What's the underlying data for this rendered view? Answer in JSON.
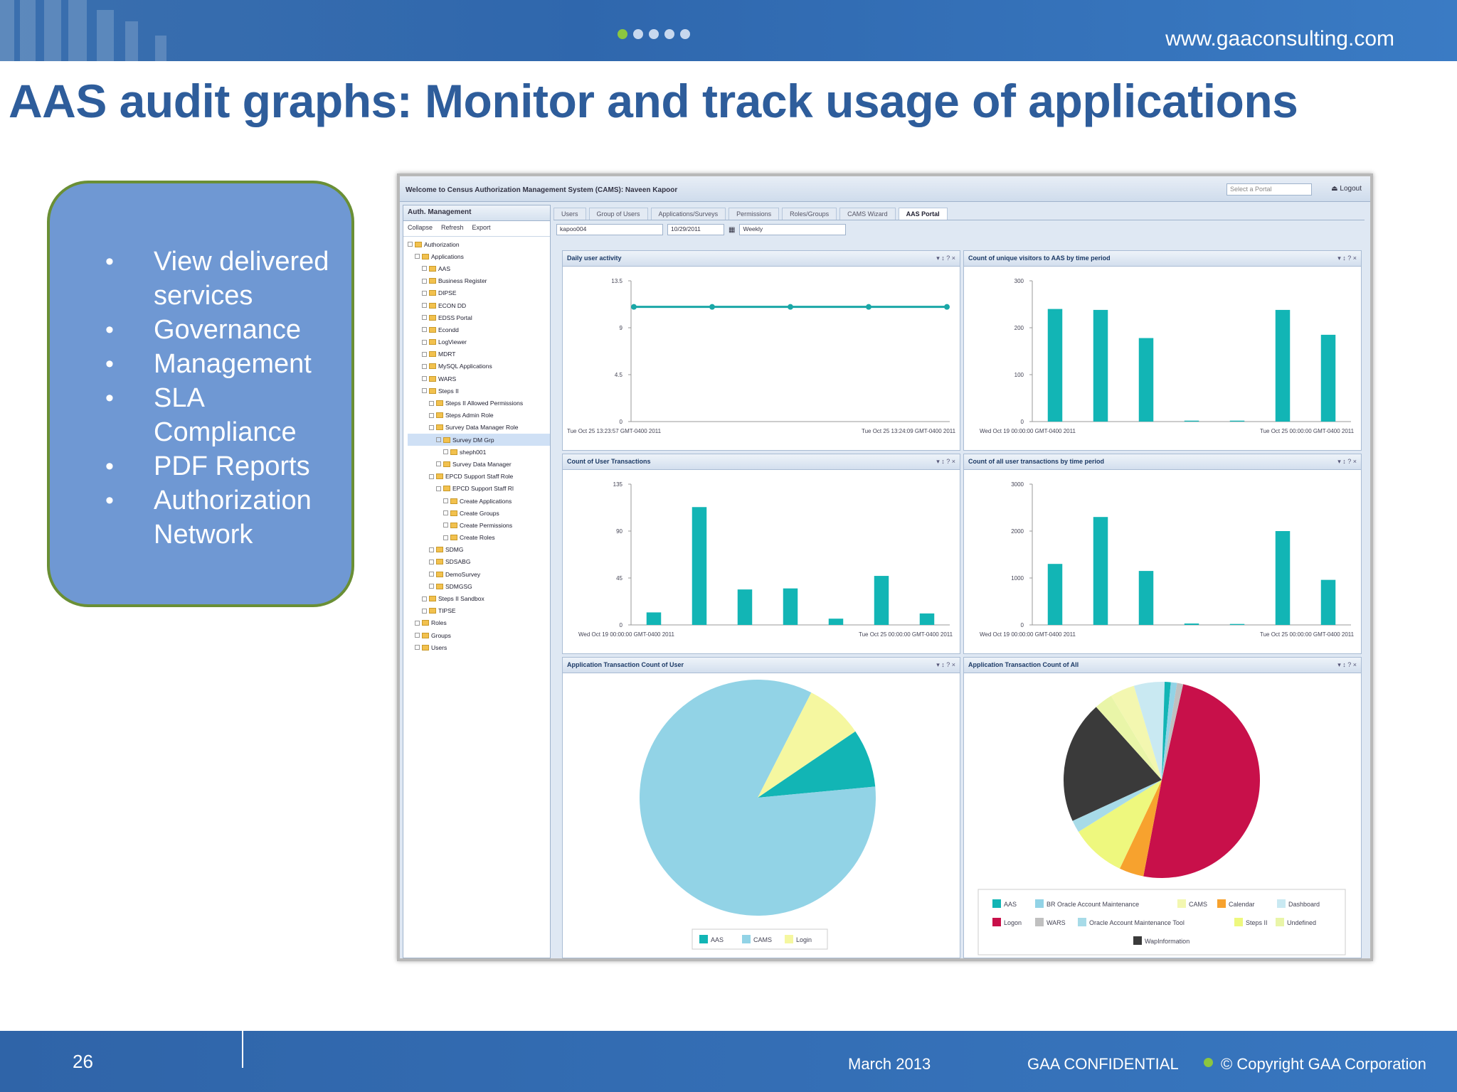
{
  "header": {
    "url": "www.gaaconsulting.com",
    "progress_dots": 5,
    "active_dot": 1,
    "accent": "#8cc63f",
    "bar_color": "#3470b5"
  },
  "slide": {
    "title": "AAS audit graphs: Monitor and track usage of applications",
    "title_color": "#2e5d9b",
    "bullets": [
      "View delivered services",
      "Governance",
      "Management",
      "SLA Compliance",
      "PDF Reports",
      "Authorization Network"
    ]
  },
  "app": {
    "window_title": "Welcome to Census Authorization Management System (CAMS): Naveen Kapoor",
    "portal_select_placeholder": "Select a Portal",
    "logout_label": "Logout",
    "sidebar_title": "Auth. Management",
    "sidebar_tools": [
      "Collapse",
      "Refresh",
      "Export"
    ],
    "tree": [
      {
        "label": "Authorization",
        "depth": 0
      },
      {
        "label": "Applications",
        "depth": 1
      },
      {
        "label": "AAS",
        "depth": 2
      },
      {
        "label": "Business Register",
        "depth": 2
      },
      {
        "label": "DIPSE",
        "depth": 2
      },
      {
        "label": "ECON DD",
        "depth": 2
      },
      {
        "label": "EDSS Portal",
        "depth": 2
      },
      {
        "label": "Econdd",
        "depth": 2
      },
      {
        "label": "LogViewer",
        "depth": 2
      },
      {
        "label": "MDRT",
        "depth": 2
      },
      {
        "label": "MySQL Applications",
        "depth": 2
      },
      {
        "label": "WARS",
        "depth": 2
      },
      {
        "label": "Steps II",
        "depth": 2
      },
      {
        "label": "Steps II Allowed Permissions",
        "depth": 3
      },
      {
        "label": "Steps Admin Role",
        "depth": 3
      },
      {
        "label": "Survey Data Manager Role",
        "depth": 3
      },
      {
        "label": "Survey DM Grp",
        "depth": 4,
        "selected": true
      },
      {
        "label": "sheph001",
        "depth": 5
      },
      {
        "label": "Survey Data Manager",
        "depth": 4
      },
      {
        "label": "EPCD Support Staff Role",
        "depth": 3
      },
      {
        "label": "EPCD Support Staff Rl",
        "depth": 4
      },
      {
        "label": "Create Applications",
        "depth": 5
      },
      {
        "label": "Create Groups",
        "depth": 5
      },
      {
        "label": "Create Permissions",
        "depth": 5
      },
      {
        "label": "Create Roles",
        "depth": 5
      },
      {
        "label": "SDMG",
        "depth": 3
      },
      {
        "label": "SDSABG",
        "depth": 3
      },
      {
        "label": "DemoSurvey",
        "depth": 3
      },
      {
        "label": "SDMGSG",
        "depth": 3
      },
      {
        "label": "Steps II Sandbox",
        "depth": 2
      },
      {
        "label": "TIPSE",
        "depth": 2
      },
      {
        "label": "Roles",
        "depth": 1
      },
      {
        "label": "Groups",
        "depth": 1
      },
      {
        "label": "Users",
        "depth": 1
      }
    ],
    "tabs": [
      {
        "label": "Users"
      },
      {
        "label": "Group of Users"
      },
      {
        "label": "Applications/Surveys"
      },
      {
        "label": "Permissions"
      },
      {
        "label": "Roles/Groups"
      },
      {
        "label": "CAMS Wizard"
      },
      {
        "label": "AAS Portal",
        "active": true
      }
    ],
    "filters": {
      "user": "kapoo004",
      "date": "10/29/2011",
      "period": "Weekly"
    },
    "panel_controls": "▾ ↕ ? ×"
  },
  "chart_data": [
    {
      "type": "line",
      "title": "Daily user activity",
      "x": [
        "Tue Oct 25 13:23:57 GMT-0400 2011",
        "",
        "",
        "Tue Oct 25 13:24:09 GMT-0400 2011",
        ""
      ],
      "series": [
        {
          "values": [
            11,
            11,
            11,
            11,
            11
          ]
        }
      ],
      "ylim": [
        0,
        13.5
      ],
      "yticks": [
        "13.5",
        "9",
        "4.5",
        "0"
      ],
      "xticks": [
        "Tue Oct 25 13:23:57 GMT-0400 2011",
        "Tue Oct 25 13:24:09 GMT-0400 2011"
      ],
      "color": "#1aa7a7"
    },
    {
      "type": "bar",
      "title": "Count of unique visitors to AAS by time period",
      "categories": [
        "1",
        "2",
        "3",
        "4",
        "5",
        "6",
        "7"
      ],
      "values": [
        240,
        238,
        178,
        2,
        2,
        238,
        185
      ],
      "ylim": [
        0,
        300
      ],
      "yticks": [
        "300",
        "200",
        "100",
        "0"
      ],
      "xticks": [
        "Wed Oct 19 00:00:00 GMT-0400 2011",
        "Tue Oct 25 00:00:00 GMT-0400 2011"
      ],
      "color": "#12b5b5"
    },
    {
      "type": "bar",
      "title": "Count of User Transactions",
      "categories": [
        "1",
        "2",
        "3",
        "4",
        "5",
        "6",
        "7"
      ],
      "values": [
        12,
        113,
        34,
        35,
        6,
        47,
        11
      ],
      "ylim": [
        0,
        135
      ],
      "yticks": [
        "135",
        "90",
        "45",
        "0"
      ],
      "xticks": [
        "Wed Oct 19 00:00:00 GMT-0400 2011",
        "Tue Oct 25 00:00:00 GMT-0400 2011"
      ],
      "color": "#12b5b5"
    },
    {
      "type": "bar",
      "title": "Count of all user transactions by time period",
      "categories": [
        "1",
        "2",
        "3",
        "4",
        "5",
        "6",
        "7"
      ],
      "values": [
        1300,
        2300,
        1150,
        30,
        20,
        2000,
        960
      ],
      "ylim": [
        0,
        3000
      ],
      "yticks": [
        "3000",
        "2000",
        "1000",
        "0"
      ],
      "xticks": [
        "Wed Oct 19 00:00:00 GMT-0400 2011",
        "Tue Oct 25 00:00:00 GMT-0400 2011"
      ],
      "color": "#12b5b5"
    },
    {
      "type": "pie",
      "title": "Application Transaction Count of User",
      "slices": [
        {
          "label": "AAS",
          "value": 8,
          "color": "#12b5b5"
        },
        {
          "label": "CAMS",
          "value": 84,
          "color": "#92d3e6"
        },
        {
          "label": "Login",
          "value": 8,
          "color": "#f5f7a0"
        }
      ]
    },
    {
      "type": "pie",
      "title": "Application Transaction Count of All",
      "slices": [
        {
          "label": "Logon",
          "value": 49,
          "color": "#c8104a"
        },
        {
          "label": "Calendar",
          "value": 4,
          "color": "#f7a22e"
        },
        {
          "label": "Steps II",
          "value": 9,
          "color": "#eef87e"
        },
        {
          "label": "Oracle Account Maintenance Tool",
          "value": 2,
          "color": "#a7dbe8"
        },
        {
          "label": "WapInformation",
          "value": 20,
          "color": "#3a3a3a"
        },
        {
          "label": "Undefined",
          "value": 3,
          "color": "#e9f5a8"
        },
        {
          "label": "CAMS",
          "value": 4,
          "color": "#f3f7b0"
        },
        {
          "label": "Dashboard",
          "value": 5,
          "color": "#c9e9f2"
        },
        {
          "label": "AAS",
          "value": 1,
          "color": "#12b5b5"
        },
        {
          "label": "BR Oracle Account Maintenance",
          "value": 1,
          "color": "#92d3e6"
        },
        {
          "label": "WARS",
          "value": 1,
          "color": "#c0c0c0"
        }
      ],
      "legend": [
        "AAS",
        "BR Oracle Account Maintenance",
        "CAMS",
        "Calendar",
        "Dashboard",
        "Logon",
        "WARS",
        "Oracle Account Maintenance Tool",
        "Steps II",
        "Undefined",
        "WapInformation"
      ]
    }
  ],
  "footer": {
    "page_number": "26",
    "date": "March 2013",
    "confidential": "GAA CONFIDENTIAL",
    "copyright": "© Copyright GAA Corporation"
  }
}
